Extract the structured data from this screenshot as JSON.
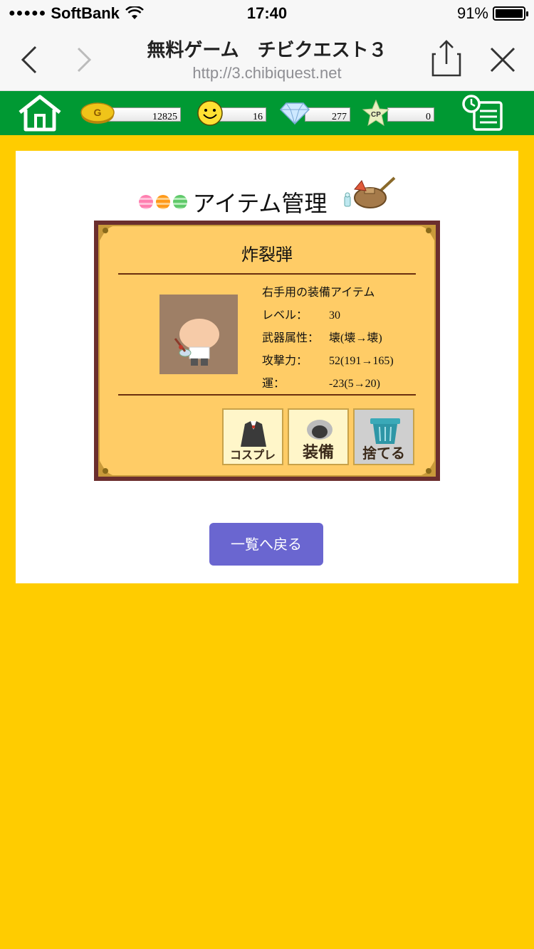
{
  "status_bar": {
    "signal": "●●●●●",
    "carrier": "SoftBank",
    "time": "17:40",
    "battery": "91%",
    "battery_level": 0.91
  },
  "browser": {
    "title": "無料ゲーム　チビクエスト３",
    "url": "http://3.chibiquest.net"
  },
  "game_bar": {
    "gold": "12825",
    "smile": "16",
    "gems": "277",
    "cp": "0",
    "coin_letter": "G",
    "cp_letter": "CP"
  },
  "page": {
    "heading": "アイテム管理"
  },
  "item": {
    "name": "炸裂弾",
    "description": "右手用の装備アイテム",
    "stats": [
      {
        "label": "レベル：",
        "value": "30"
      },
      {
        "label": "武器属性：",
        "value": "壊(壊→壊)"
      },
      {
        "label": "攻撃力：",
        "value": "52(191→165)"
      },
      {
        "label": "運：",
        "value": "-23(5→20)"
      }
    ]
  },
  "actions": {
    "cosplay": "コスプレ",
    "equip": "装備",
    "discard": "捨てる"
  },
  "back_button": "一覧へ戻る",
  "colors": {
    "background": "#FFCC00",
    "game_bar": "#009933",
    "card": "#FFCC66",
    "card_border": "#6B2E2E",
    "back_button": "#6A66D0"
  }
}
